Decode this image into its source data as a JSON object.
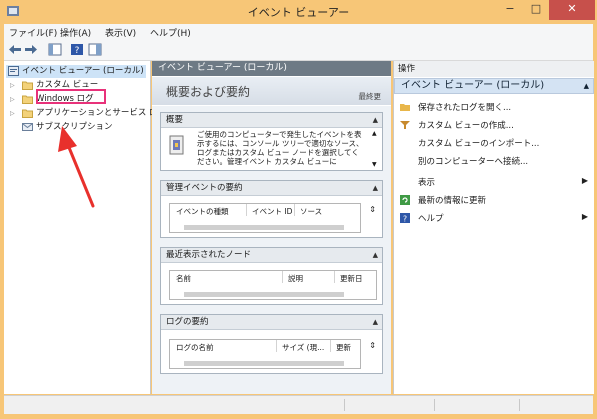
{
  "window": {
    "title": "イベント ビューアー",
    "minimize": "−",
    "maximize": "□",
    "close": "✕"
  },
  "menu": [
    "ファイル(F)",
    "操作(A)",
    "表示(V)",
    "ヘルプ(H)"
  ],
  "tree": {
    "root": "イベント ビューアー (ローカル)",
    "items": [
      "カスタム ビュー",
      "Windows ログ",
      "アプリケーションとサービス ログ",
      "サブスクリプション"
    ]
  },
  "center": {
    "header": "イベント ビューアー (ローカル)",
    "overview_title": "概要および要約",
    "last_refresh": "最終更",
    "summary": {
      "title": "概要",
      "text": "ご使用のコンピューターで発生したイベントを表示するには、コンソール ツリーで適切なソース、ログまたはカスタム ビュー ノードを選択してください。管理イベント カスタム ビューに"
    },
    "admin_events": {
      "title": "管理イベントの要約",
      "cols": [
        "イベントの種類",
        "イベント ID",
        "ソース"
      ]
    },
    "recent_nodes": {
      "title": "最近表示されたノード",
      "cols": [
        "名前",
        "説明",
        "更新日"
      ]
    },
    "log_summary": {
      "title": "ログの要約",
      "cols": [
        "ログの名前",
        "サイズ (現...",
        "更新"
      ]
    }
  },
  "actions": {
    "header": "操作",
    "section": "イベント ビューアー (ローカル)",
    "items": [
      "保存されたログを開く...",
      "カスタム ビューの作成...",
      "カスタム ビューのインポート...",
      "別のコンピューターへ接続...",
      "表示",
      "最新の情報に更新",
      "ヘルプ"
    ]
  },
  "colors": {
    "accent_highlight": "#e8327a",
    "annotation_arrow": "#e8302c",
    "title_bar": "#f7c677"
  }
}
